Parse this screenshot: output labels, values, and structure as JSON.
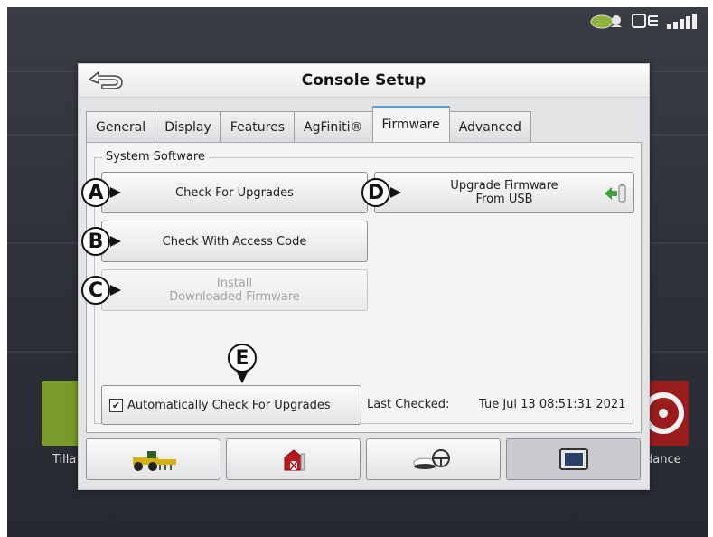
{
  "dialog": {
    "title": "Console Setup",
    "tabs": [
      {
        "label": "General"
      },
      {
        "label": "Display"
      },
      {
        "label": "Features"
      },
      {
        "label": "AgFiniti®"
      },
      {
        "label": "Firmware",
        "active": true
      },
      {
        "label": "Advanced"
      }
    ],
    "group_label": "System Software",
    "buttons": {
      "check_upgrades": "Check For Upgrades",
      "check_access_code": "Check With Access Code",
      "install_line1": "Install",
      "install_line2": "Downloaded Firmware",
      "upgrade_line1": "Upgrade Firmware",
      "upgrade_line2": "From USB"
    },
    "callouts": {
      "a": "A",
      "b": "B",
      "c": "C",
      "d": "D",
      "e": "E"
    },
    "auto_check": {
      "label": "Automatically Check For Upgrades",
      "checked": true,
      "mark": "✔"
    },
    "last_checked_label": "Last Checked:",
    "last_checked_value": "Tue Jul 13 08:51:31 2021"
  },
  "background": {
    "left_label": "Tilla",
    "right_label": "dance"
  },
  "bottom_bar": [
    {
      "icon": "tractor-icon"
    },
    {
      "icon": "barn-icon"
    },
    {
      "icon": "gps-steering-icon"
    },
    {
      "icon": "display-icon",
      "active": true
    }
  ],
  "colors": {
    "tab_accent": "#5aa0d8",
    "left_tile": "#7a9a2a",
    "right_tile": "#9b1c1c"
  }
}
